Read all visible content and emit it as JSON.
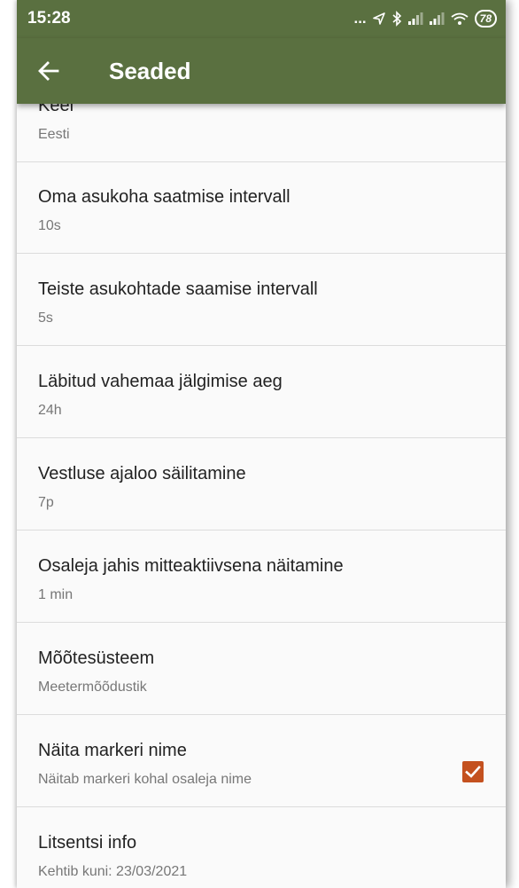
{
  "statusbar": {
    "time": "15:28",
    "dots": "...",
    "battery": "78"
  },
  "appbar": {
    "title": "Seaded",
    "back_icon": "arrow-left-icon"
  },
  "settings": [
    {
      "title": "Keel",
      "value": "Eesti"
    },
    {
      "title": "Oma asukoha saatmise intervall",
      "value": "10s"
    },
    {
      "title": "Teiste asukohtade saamise intervall",
      "value": "5s"
    },
    {
      "title": "Läbitud vahemaa jälgimise aeg",
      "value": "24h"
    },
    {
      "title": "Vestluse ajaloo säilitamine",
      "value": "7p"
    },
    {
      "title": "Osaleja jahis mitteaktiivsena näitamine",
      "value": "1 min"
    },
    {
      "title": "Mõõtesüsteem",
      "value": "Meetermõõdustik"
    },
    {
      "title": "Näita markeri nime",
      "value": "Näitab markeri kohal osaleja nime",
      "checked": true
    },
    {
      "title": "Litsentsi info",
      "value": "Kehtib kuni: 23/03/2021"
    }
  ],
  "colors": {
    "toolbar": "#5a7040",
    "checkbox": "#c4511f"
  }
}
